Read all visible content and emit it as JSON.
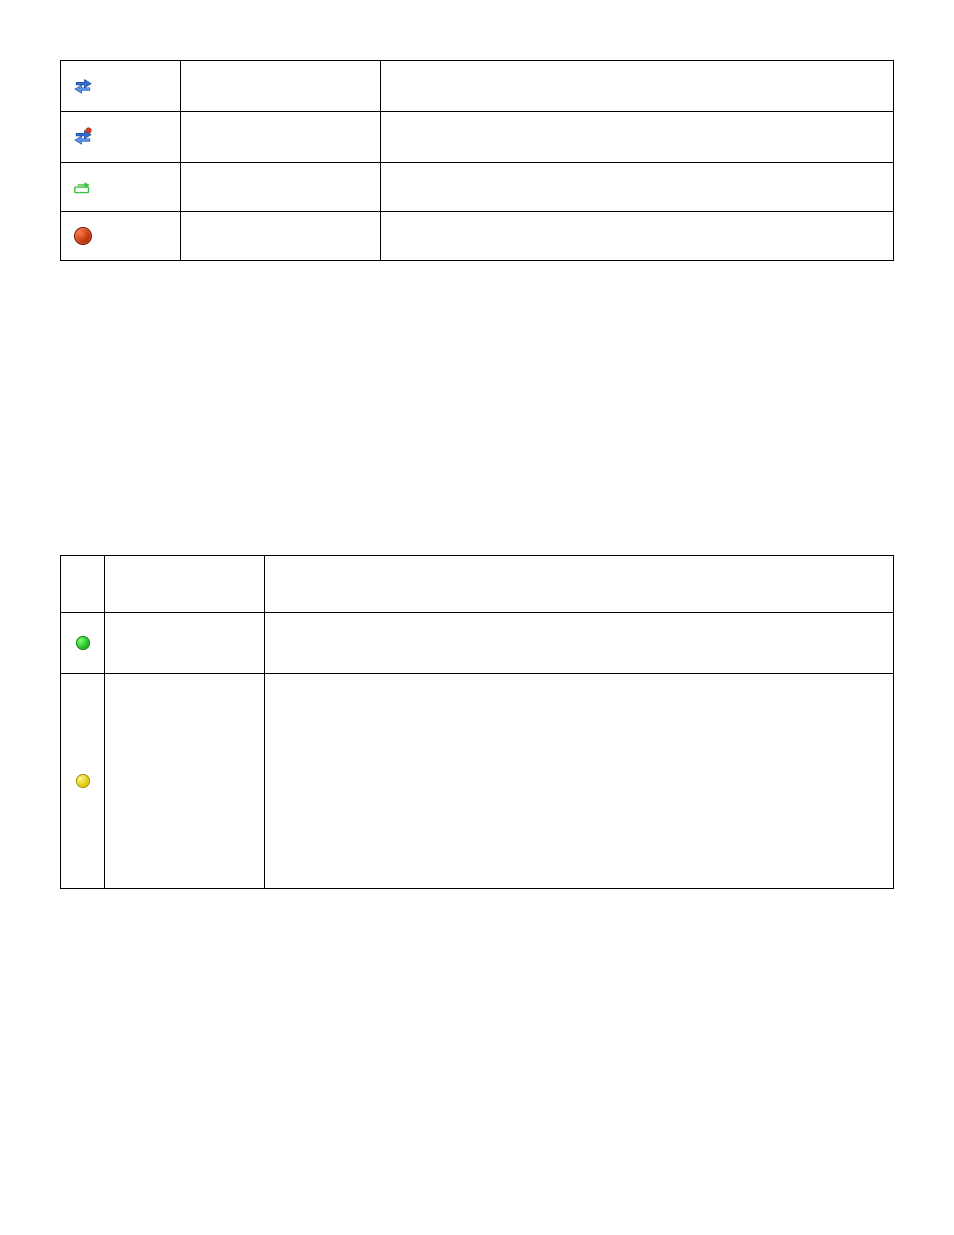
{
  "table1": {
    "rows": [
      {
        "icon": "swap-blue",
        "name": "",
        "desc": ""
      },
      {
        "icon": "swap-blue-red",
        "name": "",
        "desc": ""
      },
      {
        "icon": "drive-green",
        "name": "",
        "desc": ""
      },
      {
        "icon": "error-red",
        "name": "",
        "desc": ""
      }
    ]
  },
  "faint_link_label": " ",
  "links": [
    {
      "label": " "
    },
    {
      "label": " "
    },
    {
      "label": " "
    }
  ],
  "table2": {
    "header": {
      "c1": "",
      "c2": "",
      "c3": ""
    },
    "rows": [
      {
        "icon": "ok-green",
        "name": "",
        "desc": ""
      },
      {
        "icon": "warn-yellow",
        "name": "",
        "desc": ""
      }
    ]
  }
}
